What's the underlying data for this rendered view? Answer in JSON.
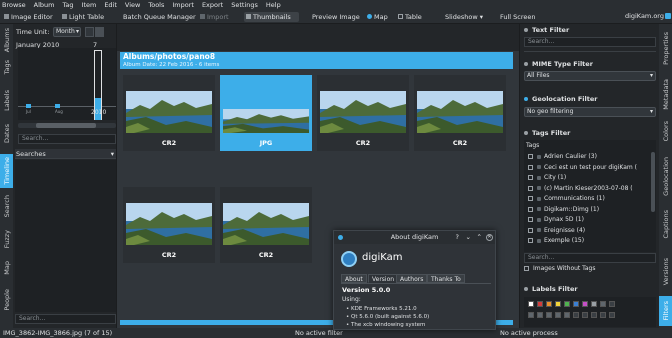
{
  "menu": [
    "Browse",
    "Album",
    "Tag",
    "Item",
    "Edit",
    "View",
    "Tools",
    "Import",
    "Export",
    "Settings",
    "Help"
  ],
  "toolbar": {
    "image_editor": "Image Editor",
    "light_table": "Light Table",
    "batch_queue": "Batch Queue Manager",
    "import": "Import",
    "thumbnails": "Thumbnails",
    "preview": "Preview Image",
    "map": "Map",
    "table": "Table",
    "slideshow": "Slideshow",
    "fullscreen": "Full Screen",
    "brand": "digiKam.org"
  },
  "left_tabs": [
    "Albums",
    "Tags",
    "Labels",
    "Dates",
    "Timeline",
    "Search",
    "Fuzzy",
    "Map",
    "People"
  ],
  "timeline": {
    "time_unit_label": "Time Unit:",
    "time_unit_value": "Month",
    "period": "January 2010",
    "count": "7 items",
    "x_labels": [
      "Jul",
      "Aug"
    ],
    "year_label": "2010",
    "searches_label": "Searches",
    "search_placeholder": "Search..."
  },
  "album": {
    "path": "Albums/photos/pano8",
    "info": "Album Date: 22 Feb 2016 - 6 items"
  },
  "thumbnails": [
    {
      "label": "CR2",
      "selected": false
    },
    {
      "label": "JPG",
      "selected": true
    },
    {
      "label": "CR2",
      "selected": false
    },
    {
      "label": "CR2",
      "selected": false
    },
    {
      "label": "CR2",
      "selected": false
    },
    {
      "label": "CR2",
      "selected": false
    }
  ],
  "right_panel": {
    "text_filter": "Text Filter",
    "text_filter_placeholder": "Search...",
    "mime_filter": "MIME Type Filter",
    "mime_value": "All Files",
    "geo_filter": "Geolocation Filter",
    "geo_value": "No geo filtering",
    "tags_filter": "Tags Filter",
    "tags_root": "Tags",
    "tags": [
      "Adrien Caulier (3)",
      "Ceci est un test pour digiKam (",
      "City (1)",
      "(c) Martin Kieser2003-07-08 (",
      "Communications (1)",
      "Digikam::Dimg (1)",
      "Dynax 5D (1)",
      "Ereignisse (4)",
      "Exemple (15)"
    ],
    "tags_search_placeholder": "Search...",
    "without_tags": "Images Without Tags",
    "labels_filter": "Labels Filter"
  },
  "right_tabs": [
    "Properties",
    "Metadata",
    "Colors",
    "Geolocation",
    "Captions",
    "Versions",
    "Filters"
  ],
  "dialog": {
    "title": "About digiKam",
    "app_name": "digiKam",
    "tabs": [
      "About",
      "Version",
      "Authors",
      "Thanks To"
    ],
    "version": "Version 5.0.0",
    "using": "Using:",
    "libs": [
      "KDE Frameworks 5.21.0",
      "Qt 5.6.0 (built against 5.6.0)",
      "The xcb windowing system"
    ]
  },
  "status": {
    "file": "IMG_3862-IMG_3866.jpg (7 of 15)",
    "active_filter": "No active filter",
    "active_process": "No active process"
  },
  "colors": {
    "accent": "#3daee9",
    "background": "#232629",
    "panel": "#31363b"
  }
}
